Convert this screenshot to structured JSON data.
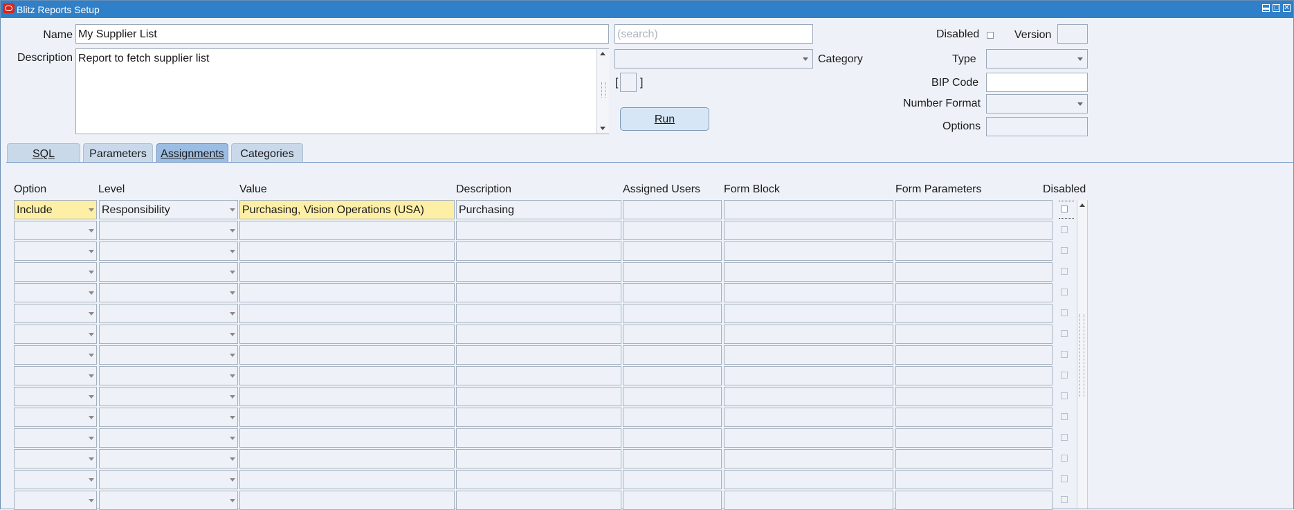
{
  "window": {
    "title": "Blitz Reports Setup"
  },
  "header": {
    "name_label": "Name",
    "name_value": "My Supplier List",
    "search_placeholder": "(search)",
    "description_label": "Description",
    "description_value": "Report to fetch supplier list",
    "category_label": "Category",
    "bracket_open": "[",
    "bracket_close": "]",
    "run_label": "Run",
    "disabled_label": "Disabled",
    "version_label": "Version",
    "type_label": "Type",
    "bip_code_label": "BIP Code",
    "number_format_label": "Number Format",
    "options_label": "Options"
  },
  "tabs": [
    {
      "label": "SQL",
      "active": false
    },
    {
      "label": "Parameters",
      "active": false
    },
    {
      "label": "Assignments",
      "active": true
    },
    {
      "label": "Categories",
      "active": false
    }
  ],
  "table": {
    "columns": [
      "Option",
      "Level",
      "Value",
      "Description",
      "Assigned Users",
      "Form Block",
      "Form Parameters",
      "Disabled"
    ],
    "rows": [
      {
        "option": "Include",
        "level": "Responsibility",
        "value": "Purchasing, Vision Operations (USA)",
        "description": "Purchasing",
        "assigned_users": "",
        "form_block": "",
        "form_parameters": ""
      }
    ],
    "empty_row_count": 14
  },
  "colors": {
    "title_bar": "#2f7fc9",
    "highlight": "#fdefa6",
    "background": "#eef2f8"
  }
}
